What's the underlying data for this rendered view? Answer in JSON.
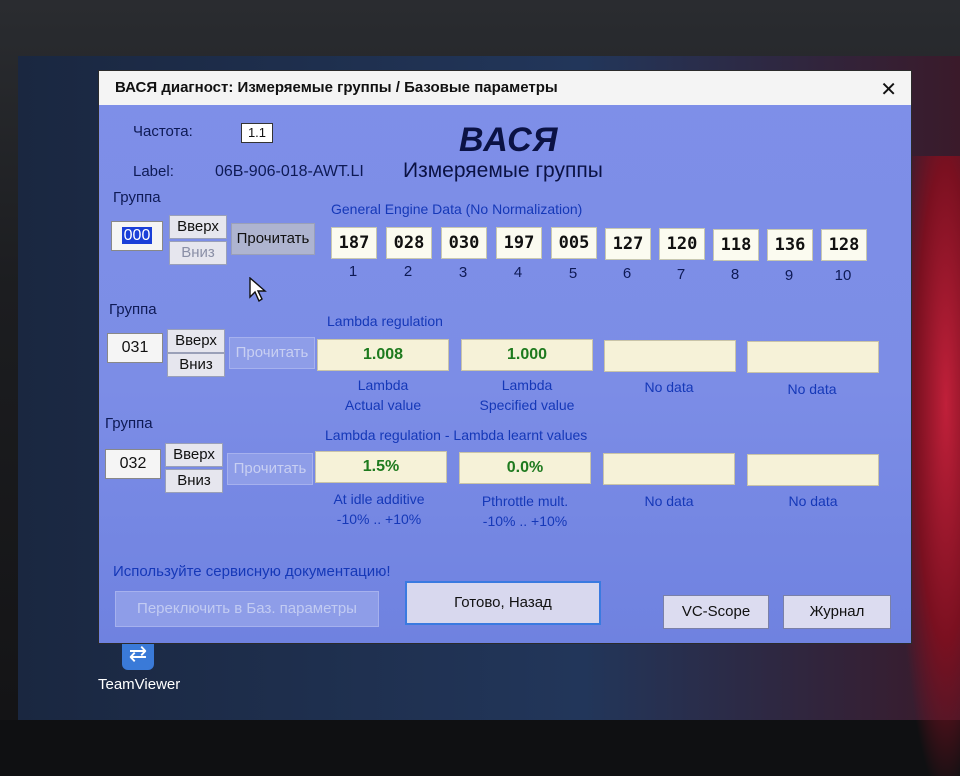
{
  "window": {
    "title": "ВАСЯ диагност: Измеряемые группы / Базовые параметры",
    "close_glyph": "✕"
  },
  "header": {
    "freq_label": "Частота:",
    "freq_value": "1.1",
    "label_label": "Label:",
    "label_value": "06B-906-018-AWT.LI",
    "app_name": "ВАСЯ",
    "screen_title": "Измеряемые группы"
  },
  "groups": [
    {
      "label": "Группа",
      "number": "000",
      "up": "Вверх",
      "down": "Вниз",
      "read": "Прочитать",
      "description": "General Engine Data (No Normalization)",
      "values": [
        "187",
        "028",
        "030",
        "197",
        "005",
        "127",
        "120",
        "118",
        "136",
        "128"
      ],
      "indices": [
        "1",
        "2",
        "3",
        "4",
        "5",
        "6",
        "7",
        "8",
        "9",
        "10"
      ]
    },
    {
      "label": "Группа",
      "number": "031",
      "up": "Вверх",
      "down": "Вниз",
      "read": "Прочитать",
      "description": "Lambda regulation",
      "fields": [
        {
          "value": "1.008",
          "caption1": "Lambda",
          "caption2": "Actual value"
        },
        {
          "value": "1.000",
          "caption1": "Lambda",
          "caption2": "Specified value"
        },
        {
          "value": "",
          "caption1": "No data",
          "caption2": ""
        },
        {
          "value": "",
          "caption1": "No data",
          "caption2": ""
        }
      ]
    },
    {
      "label": "Группа",
      "number": "032",
      "up": "Вверх",
      "down": "Вниз",
      "read": "Прочитать",
      "description": "Lambda regulation - Lambda learnt values",
      "fields": [
        {
          "value": "1.5%",
          "caption1": "At idle additive",
          "caption2": "-10% .. +10%"
        },
        {
          "value": "0.0%",
          "caption1": "Pthrottle mult.",
          "caption2": "-10% .. +10%"
        },
        {
          "value": "",
          "caption1": "No data",
          "caption2": ""
        },
        {
          "value": "",
          "caption1": "No data",
          "caption2": ""
        }
      ]
    }
  ],
  "footer": {
    "note": "Используйте сервисную документацию!",
    "switch_button": "Переключить в Баз. параметры",
    "done_button": "Готово, Назад",
    "scope_button": "VC-Scope",
    "log_button": "Журнал"
  },
  "desktop": {
    "teamviewer_label": "TeamViewer"
  }
}
